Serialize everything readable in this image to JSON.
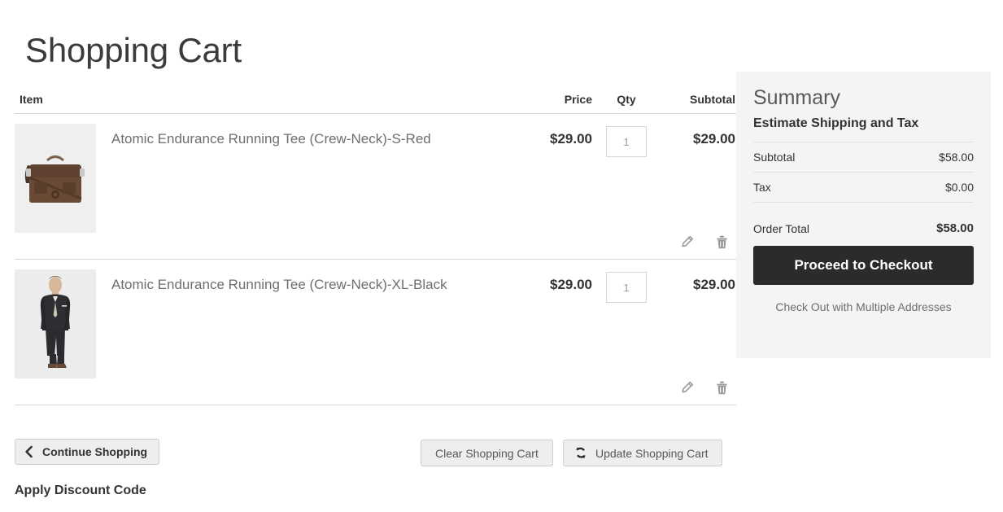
{
  "page": {
    "title": "Shopping Cart"
  },
  "cart_table": {
    "headers": {
      "item": "Item",
      "price": "Price",
      "qty": "Qty",
      "subtotal": "Subtotal"
    },
    "rows": [
      {
        "name": "Atomic Endurance Running Tee (Crew-Neck)-S-Red",
        "price": "$29.00",
        "qty": "1",
        "subtotal": "$29.00",
        "image_alt": "brown-leather-messenger-bag"
      },
      {
        "name": "Atomic Endurance Running Tee (Crew-Neck)-XL-Black",
        "price": "$29.00",
        "qty": "1",
        "subtotal": "$29.00",
        "image_alt": "man-in-dark-suit"
      }
    ],
    "row_actions": {
      "edit": "edit-item",
      "delete": "remove-item"
    }
  },
  "actions": {
    "continue_shopping": "Continue Shopping",
    "clear_cart": "Clear Shopping Cart",
    "update_cart": "Update Shopping Cart"
  },
  "discount": {
    "title": "Apply Discount Code"
  },
  "summary": {
    "title": "Summary",
    "subtitle": "Estimate Shipping and Tax",
    "lines": [
      {
        "label": "Subtotal",
        "value": "$58.00"
      },
      {
        "label": "Tax",
        "value": "$0.00"
      }
    ],
    "order_total": {
      "label": "Order Total",
      "value": "$58.00"
    },
    "checkout_button": "Proceed to Checkout",
    "multiple_addresses": "Check Out with Multiple Addresses"
  },
  "colors": {
    "checkout_button_bg": "#2b2b2b",
    "summary_bg": "#f4f4f4",
    "border": "#d6d6d6",
    "product_name": "#6e6e6e"
  }
}
